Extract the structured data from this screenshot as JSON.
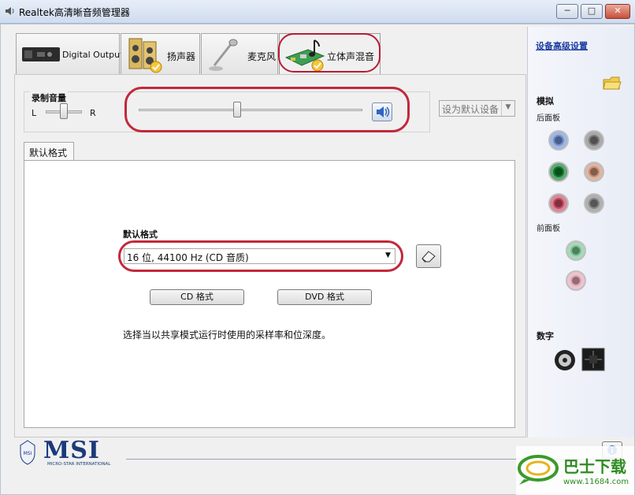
{
  "window": {
    "title": "Realtek高清晰音频管理器"
  },
  "tabs": [
    {
      "label": "Digital Output"
    },
    {
      "label": "扬声器"
    },
    {
      "label": "麦克风"
    },
    {
      "label": "立体声混音"
    }
  ],
  "recording": {
    "group_label": "录制音量",
    "left": "L",
    "right": "R",
    "volume_level": 0.44,
    "balance_level": 0.5,
    "default_device": "设为默认设备"
  },
  "format_tab": {
    "tab_label": "默认格式",
    "field_label": "默认格式",
    "selected": "16 位, 44100 Hz (CD 音质)",
    "cd_button": "CD 格式",
    "dvd_button": "DVD 格式",
    "description": "选择当以共享模式运行时使用的采样率和位深度。"
  },
  "sidebar": {
    "advanced_link": "设备高级设置",
    "analog_heading": "模拟",
    "rear_panel": "后面板",
    "front_panel": "前面板",
    "digital_heading": "数字",
    "rear_jacks": [
      "#6f8fcf",
      "#7b7b7b",
      "#0e7a2c",
      "#c98f76",
      "#c34a62",
      "#858585"
    ],
    "front_jacks": [
      "#7bc494",
      "#e2a6b4"
    ]
  },
  "footer": {
    "brand": "MSI",
    "brand_sub": "MICRO-STAR INTERNATIONAL"
  },
  "watermark": {
    "site": "巴士下载",
    "url": "www.11684.com"
  }
}
